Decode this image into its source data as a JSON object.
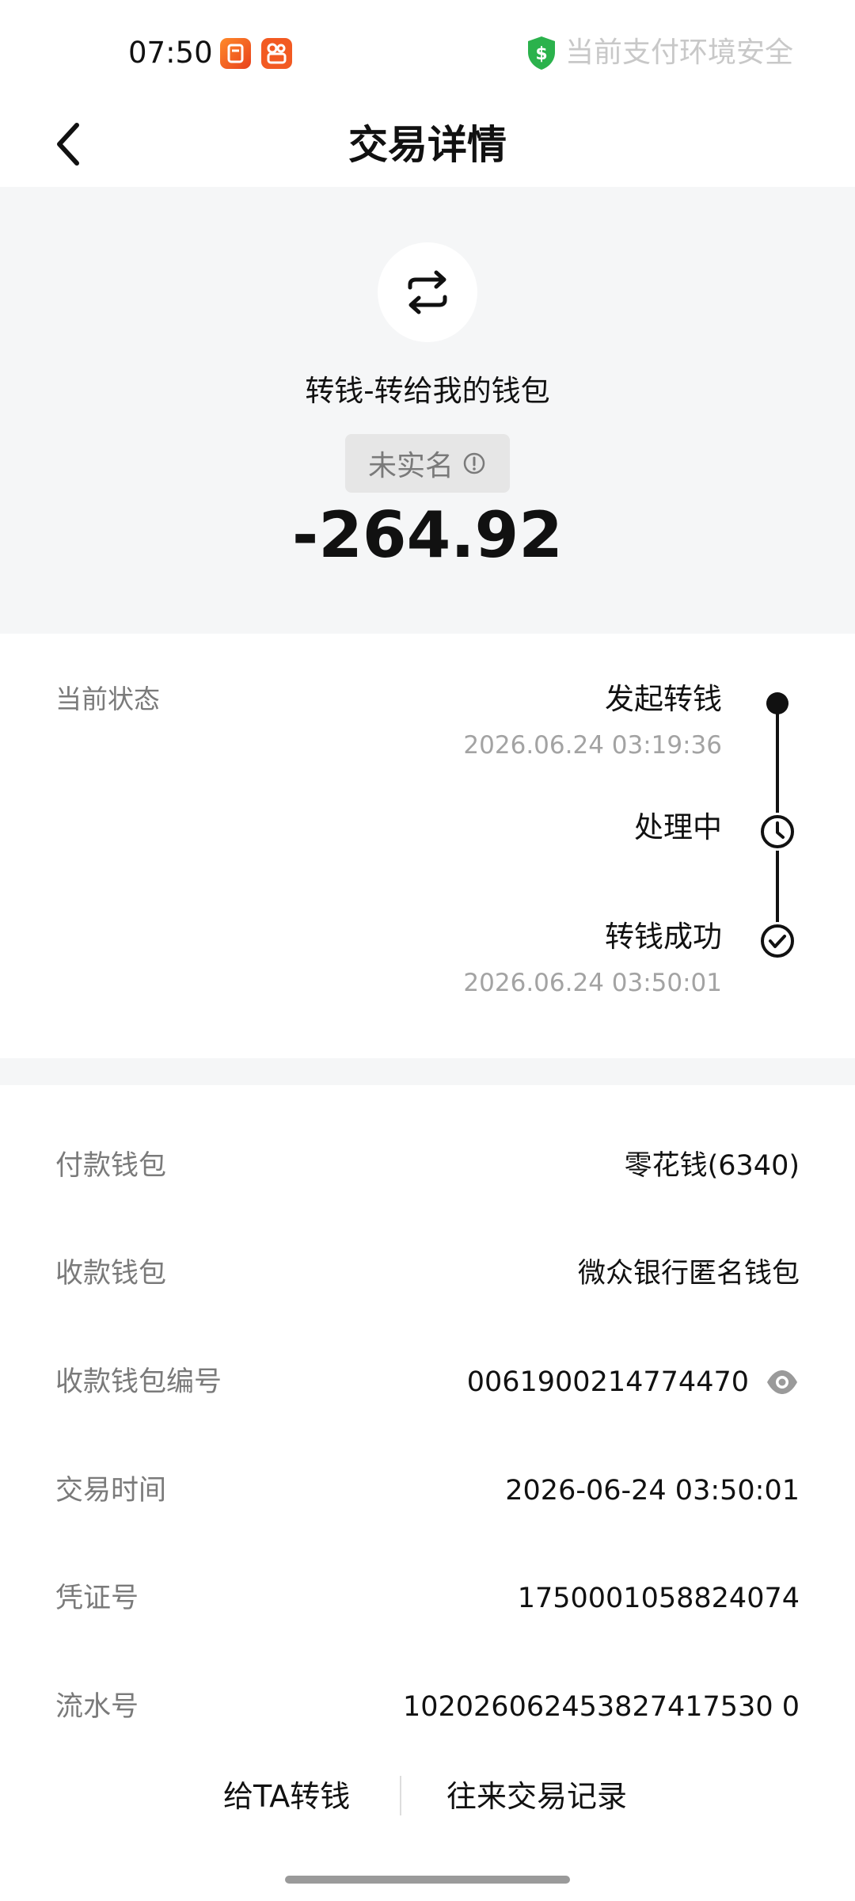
{
  "status_bar": {
    "time": "07:50",
    "notification_icons": [
      "pinduoduo-app-icon",
      "kuaishou-app-icon"
    ],
    "security_icon": "green-shield-dollar-icon",
    "security_text": "当前支付环境安全"
  },
  "nav": {
    "back_icon": "chevron-left-icon",
    "title": "交易详情"
  },
  "hero": {
    "icon": "transfer-arrows-icon",
    "description": "转钱-转给我的钱包",
    "badge_text": "未实名",
    "badge_icon": "info-circle-icon",
    "amount": "-264.92"
  },
  "status": {
    "label": "当前状态",
    "steps": [
      {
        "title": "发起转钱",
        "time": "2026.06.24 03:19:36",
        "icon": "filled-dot"
      },
      {
        "title": "处理中",
        "time": "",
        "icon": "clock-icon"
      },
      {
        "title": "转钱成功",
        "time": "2026.06.24 03:50:01",
        "icon": "check-circle-icon"
      }
    ]
  },
  "details": [
    {
      "label": "付款钱包",
      "value": "零花钱(6340)"
    },
    {
      "label": "收款钱包",
      "value": "微众银行匿名钱包"
    },
    {
      "label": "收款钱包编号",
      "value": "0061900214774470",
      "icon": "eye-icon"
    },
    {
      "label": "交易时间",
      "value": "2026-06-24 03:50:01"
    },
    {
      "label": "凭证号",
      "value": "1750001058824074"
    },
    {
      "label": "流水号",
      "value": "102026062453827417530 0"
    }
  ],
  "actions": {
    "transfer_label": "给TA转钱",
    "history_label": "往来交易记录"
  },
  "colors": {
    "background": "#ffffff",
    "section_background": "#f5f6f7",
    "primary_text": "#111111",
    "secondary_text": "#7a7a7a",
    "muted_text": "#a3a3a3",
    "security_green": "#2bb24c"
  }
}
